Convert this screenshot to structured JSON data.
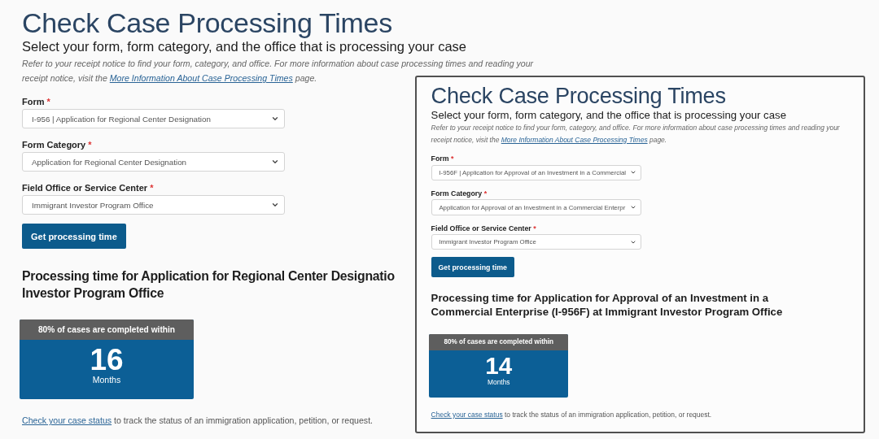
{
  "panels": [
    {
      "kind": "background",
      "title": "Check Case Processing Times",
      "subtitle": "Select your form, form category, and the office that is processing your case",
      "notice": {
        "before": "Refer to your receipt notice to find your form, category, and office. For more information about case processing times and reading your receipt notice, visit the ",
        "link": "More Information About Case Processing Times",
        "after": " page."
      },
      "fields": [
        {
          "label": "Form",
          "required_mark": "*",
          "value": "I-956 | Application for Regional Center Designation"
        },
        {
          "label": "Form Category",
          "required_mark": "*",
          "value": "Application for Regional Center Designation"
        },
        {
          "label": "Field Office or Service Center",
          "required_mark": "*",
          "value": "Immigrant Investor Program Office"
        }
      ],
      "button": "Get processing time",
      "result": {
        "heading_lines": [
          "Processing time for Application for Regional Center Designatio",
          "Investor Program Office"
        ],
        "caption": "80% of cases are completed within",
        "value": "16",
        "unit": "Months"
      },
      "footer": {
        "link": "Check your case status",
        "text": " to track the status of an immigration application, petition, or request."
      }
    },
    {
      "kind": "inset",
      "title": "Check Case Processing Times",
      "subtitle": "Select your form, form category, and the office that is processing your case",
      "notice": {
        "before": "Refer to your receipt notice to find your form, category, and office. For more information about case processing times and reading your receipt notice, visit the ",
        "link": "More Information About Case Processing Times",
        "after": " page."
      },
      "fields": [
        {
          "label": "Form",
          "required_mark": "*",
          "value": "I-956F | Application for Approval of an Investment in a Commercial"
        },
        {
          "label": "Form Category",
          "required_mark": "*",
          "value": "Application for Approval of an Investment in a Commercial Enterpr"
        },
        {
          "label": "Field Office or Service Center",
          "required_mark": "*",
          "value": "Immigrant Investor Program Office"
        }
      ],
      "button": "Get processing time",
      "result": {
        "heading_lines": [
          "Processing time for Application for Approval of an Investment in a Commercial Enterprise (I-956F) at Immigrant Investor Program Office"
        ],
        "caption": "80% of cases are completed within",
        "value": "14",
        "unit": "Months"
      },
      "footer": {
        "link": "Check your case status",
        "text": " to track the status of an immigration application, petition, or request."
      }
    }
  ]
}
